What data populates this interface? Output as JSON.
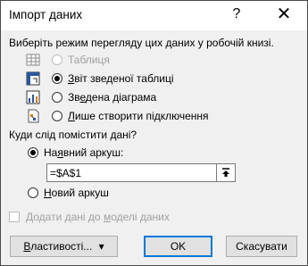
{
  "window": {
    "title": "Імпорт даних",
    "help_label": "?",
    "close_label": "✕"
  },
  "view_mode": {
    "heading": "Виберіть режим перегляду цих даних у робочій книзі.",
    "options": [
      {
        "label": "Таблиця",
        "checked": false,
        "enabled": false,
        "icon": "table-icon"
      },
      {
        "label_u": "З",
        "label_rest": "віт зведеної таблиці",
        "checked": true,
        "enabled": true,
        "icon": "pivot-table-icon"
      },
      {
        "label_pre": "Зв",
        "label_u": "е",
        "label_rest": "дена діаграма",
        "checked": false,
        "enabled": true,
        "icon": "pivot-chart-icon"
      },
      {
        "label_u": "Л",
        "label_rest": "ише створити підключення",
        "checked": false,
        "enabled": true,
        "icon": "connection-only-icon"
      }
    ]
  },
  "location": {
    "heading": "Куди слід помістити дані?",
    "existing_pre": "На",
    "existing_u": "я",
    "existing_rest": "вний аркуш:",
    "existing_checked": true,
    "reference_value": "=$A$1",
    "collapse_icon": "collapse-dialog-icon",
    "new_u": "Н",
    "new_rest": "овий аркуш",
    "new_checked": false
  },
  "data_model": {
    "pre": "Додати дані до ",
    "u": "м",
    "rest": "оделі даних",
    "checked": false,
    "enabled": false
  },
  "buttons": {
    "properties_u": "В",
    "properties_rest": "ластивості...",
    "properties_arrow": "▾",
    "ok": "OK",
    "cancel": "Скасувати"
  },
  "colors": {
    "accent": "#0078d7",
    "dialog_bg": "#f0f0f0",
    "disabled_text": "#a0a0a0"
  }
}
